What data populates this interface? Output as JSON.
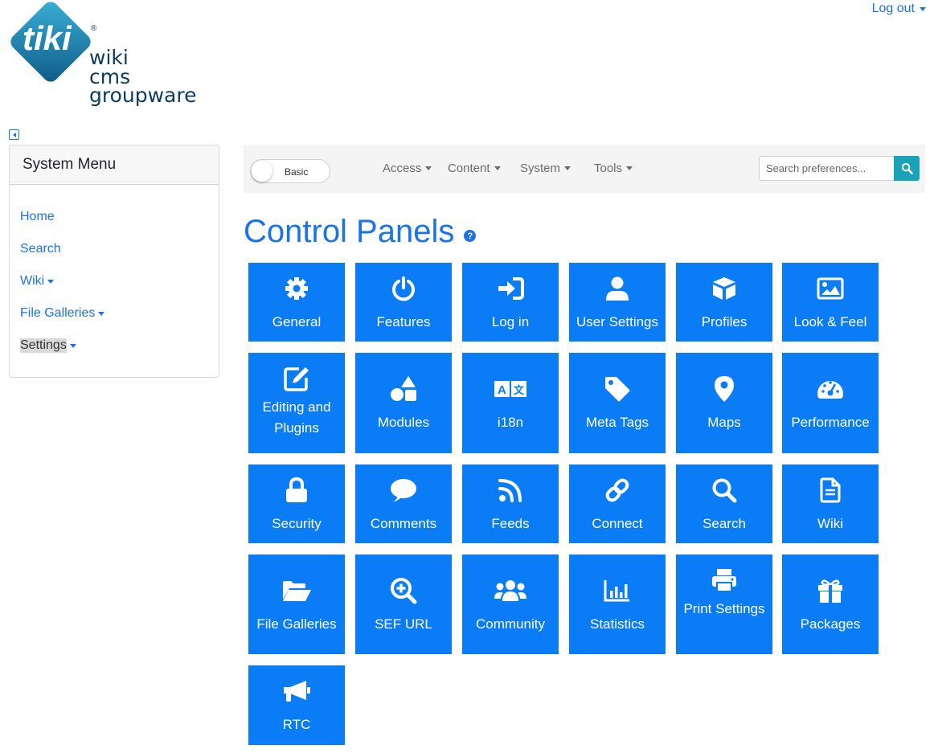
{
  "header": {
    "logo": {
      "tiki": "tiki",
      "registered": "®",
      "line1": "wiki",
      "line2": "cms",
      "line3": "groupware"
    },
    "logout_label": "Log out"
  },
  "sidebar": {
    "title": "System Menu",
    "items": [
      {
        "label": "Home"
      },
      {
        "label": "Search"
      },
      {
        "label": "Wiki"
      },
      {
        "label": "File Galleries"
      },
      {
        "label": "Settings"
      }
    ]
  },
  "topbar": {
    "mode_label": "Basic",
    "nav": [
      "Access",
      "Content",
      "System",
      "Tools"
    ],
    "search_placeholder": "Search preferences..."
  },
  "main": {
    "title": "Control Panels",
    "help_glyph": "?",
    "tiles": [
      {
        "label": "General",
        "icon": "gear-icon"
      },
      {
        "label": "Features",
        "icon": "power-icon"
      },
      {
        "label": "Log in",
        "icon": "sign-in-icon"
      },
      {
        "label": "User Settings",
        "icon": "user-icon"
      },
      {
        "label": "Profiles",
        "icon": "cube-icon"
      },
      {
        "label": "Look & Feel",
        "icon": "image-icon"
      },
      {
        "label": "Editing and Plugins",
        "icon": "edit-icon"
      },
      {
        "label": "Modules",
        "icon": "shapes-icon"
      },
      {
        "label": "i18n",
        "icon": "language-icon"
      },
      {
        "label": "Meta Tags",
        "icon": "tag-icon"
      },
      {
        "label": "Maps",
        "icon": "map-marker-icon"
      },
      {
        "label": "Performance",
        "icon": "tachometer-icon"
      },
      {
        "label": "Security",
        "icon": "lock-icon"
      },
      {
        "label": "Comments",
        "icon": "comment-icon"
      },
      {
        "label": "Feeds",
        "icon": "rss-icon"
      },
      {
        "label": "Connect",
        "icon": "link-icon"
      },
      {
        "label": "Search",
        "icon": "search-icon"
      },
      {
        "label": "Wiki",
        "icon": "file-icon"
      },
      {
        "label": "File Galleries",
        "icon": "folder-open-icon"
      },
      {
        "label": "SEF URL",
        "icon": "search-plus-icon"
      },
      {
        "label": "Community",
        "icon": "users-icon"
      },
      {
        "label": "Statistics",
        "icon": "chart-bar-icon"
      },
      {
        "label": "Print Settings",
        "icon": "print-icon"
      },
      {
        "label": "Packages",
        "icon": "gift-icon"
      },
      {
        "label": "RTC",
        "icon": "bullhorn-icon"
      }
    ]
  },
  "colors": {
    "accent": "#1a73e8",
    "tile": "#0a7cf5",
    "search_button": "#1aa3b8"
  }
}
